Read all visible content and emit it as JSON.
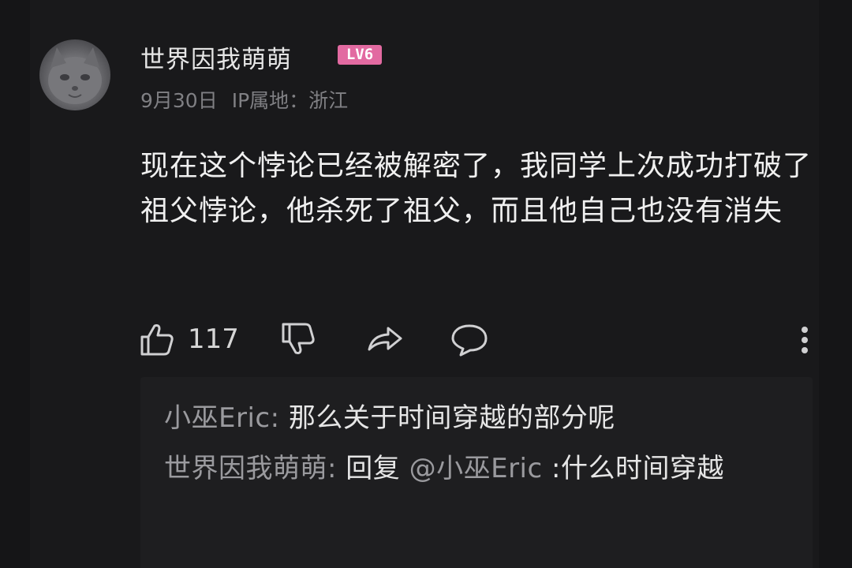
{
  "comment": {
    "username": "世界因我萌萌",
    "level_badge": "LV6",
    "date": "9月30日",
    "ip_location": "IP属地：浙江",
    "text": "现在这个悖论已经被解密了，我同学上次成功打破了祖父悖论，他杀死了祖父，而且他自己也没有消失",
    "like_count": "117"
  },
  "replies": [
    {
      "author": "小巫Eric:",
      "text": "那么关于时间穿越的部分呢"
    },
    {
      "author": "世界因我萌萌:",
      "prefix": "回复",
      "mention": "@小巫Eric",
      "text": ":什么时间穿越"
    }
  ],
  "icons": {
    "like": "thumbs-up-icon",
    "dislike": "thumbs-down-icon",
    "share": "share-icon",
    "comment": "comment-bubble-icon",
    "more": "more-vertical-icon"
  },
  "colors": {
    "background": "#19191b",
    "reply_background": "#1e1e20",
    "badge": "#e26aa1"
  }
}
